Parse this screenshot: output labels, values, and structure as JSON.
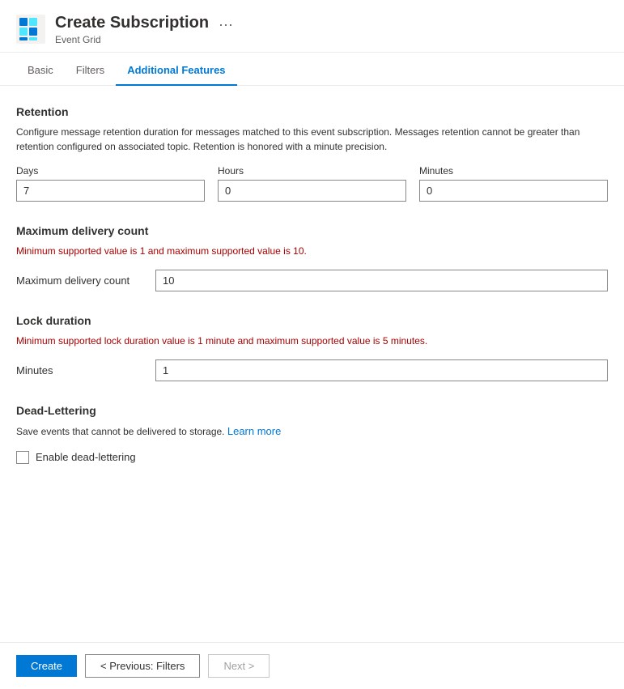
{
  "header": {
    "title": "Create Subscription",
    "subtitle": "Event Grid",
    "more_icon": "···"
  },
  "tabs": [
    {
      "id": "basic",
      "label": "Basic",
      "active": false
    },
    {
      "id": "filters",
      "label": "Filters",
      "active": false
    },
    {
      "id": "additional-features",
      "label": "Additional Features",
      "active": true
    }
  ],
  "sections": {
    "retention": {
      "title": "Retention",
      "description": "Configure message retention duration for messages matched to this event subscription. Messages retention cannot be greater than retention configured on associated topic. Retention is honored with a minute precision.",
      "days_label": "Days",
      "days_value": "7",
      "hours_label": "Hours",
      "hours_value": "0",
      "minutes_label": "Minutes",
      "minutes_value": "0"
    },
    "max_delivery": {
      "title": "Maximum delivery count",
      "description": "Minimum supported value is 1 and maximum supported value is 10.",
      "field_label": "Maximum delivery count",
      "field_value": "10"
    },
    "lock_duration": {
      "title": "Lock duration",
      "description": "Minimum supported lock duration value is 1 minute and maximum supported value is 5 minutes.",
      "field_label": "Minutes",
      "field_value": "1"
    },
    "dead_lettering": {
      "title": "Dead-Lettering",
      "description": "Save events that cannot be delivered to storage.",
      "learn_more_label": "Learn more",
      "learn_more_href": "#",
      "checkbox_label": "Enable dead-lettering",
      "checkbox_checked": false
    }
  },
  "footer": {
    "create_label": "Create",
    "previous_label": "< Previous: Filters",
    "next_label": "Next >"
  }
}
